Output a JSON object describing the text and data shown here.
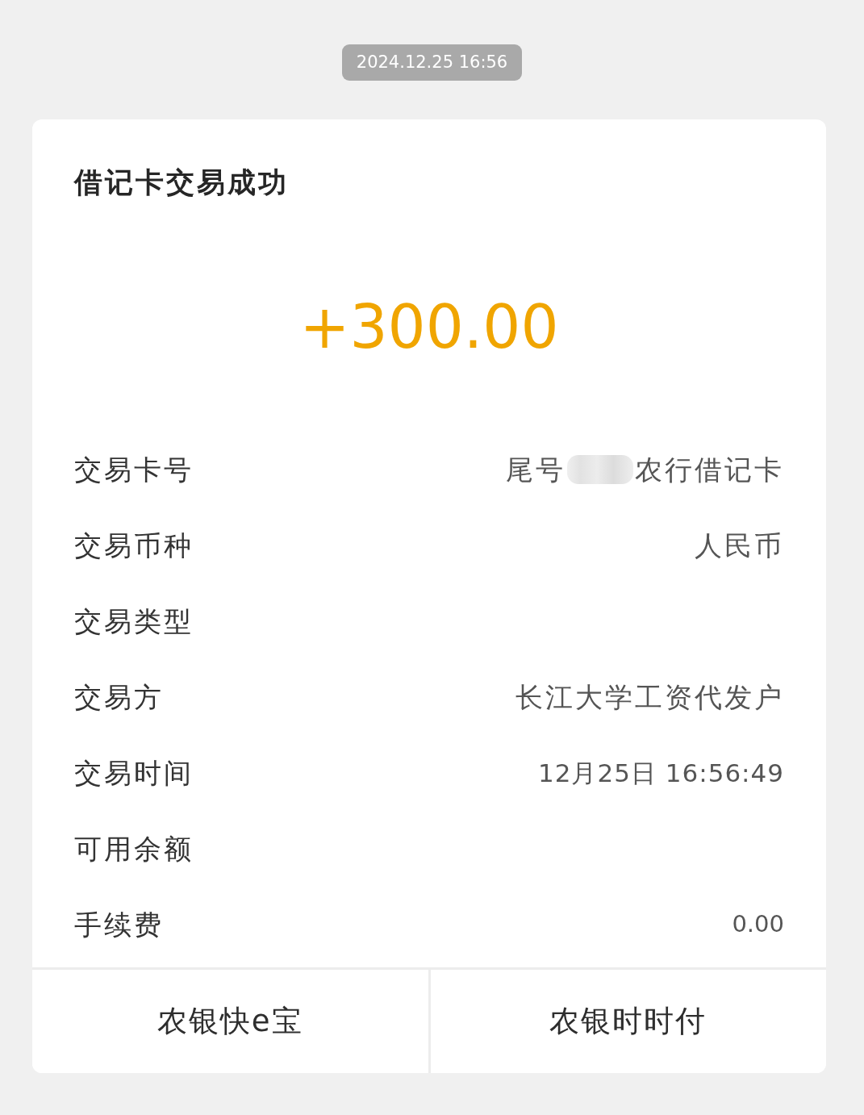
{
  "timestamp": "2024.12.25 16:56",
  "card": {
    "title": "借记卡交易成功",
    "amount": "+300.00",
    "rows": [
      {
        "label": "交易卡号",
        "value": "尾号",
        "redacted": true,
        "value_suffix": "农行借记卡"
      },
      {
        "label": "交易币种",
        "value": "人民币",
        "redacted": false
      },
      {
        "label": "交易类型",
        "redacted": false
      },
      {
        "label": "交易方",
        "value": "长江大学工资代发户",
        "redacted": false
      },
      {
        "label": "交易时间",
        "value": "12月25日 16:56:49",
        "redacted": false
      },
      {
        "label": "可用余额",
        "redacted": false
      },
      {
        "label": "手续费",
        "value": "0.00",
        "redacted": false
      }
    ],
    "actions": [
      {
        "label": "农银快e宝"
      },
      {
        "label": "农银时时付"
      }
    ]
  }
}
